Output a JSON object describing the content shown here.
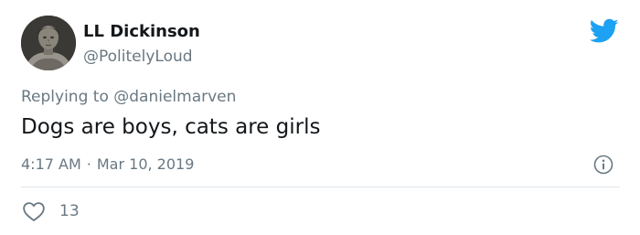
{
  "user": {
    "display_name": "LL Dickinson",
    "handle": "@PolitelyLoud",
    "avatar": "statue-bust-avatar"
  },
  "reply": {
    "prefix": "Replying to",
    "to_handle": "@danielmarven"
  },
  "tweet": {
    "text": "Dogs are boys, cats are girls",
    "time": "4:17 AM",
    "separator": "·",
    "date": "Mar 10, 2019"
  },
  "actions": {
    "like_icon": "heart-icon",
    "like_count": "13",
    "info_icon": "info-icon"
  },
  "colors": {
    "twitter_blue": "#1da1f2",
    "secondary_text": "#697882",
    "primary_text": "#14171a",
    "divider": "#e1e8ed"
  }
}
